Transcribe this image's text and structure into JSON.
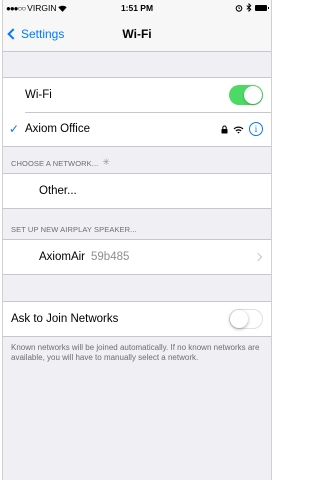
{
  "status_bar": {
    "signal": "●●●○○",
    "carrier": "VIRGIN",
    "time": "1:51 PM"
  },
  "nav": {
    "back_label": "Settings",
    "title": "Wi-Fi"
  },
  "wifi": {
    "label": "Wi-Fi",
    "enabled": true
  },
  "current_network": {
    "name": "Axiom Office",
    "info_glyph": "i"
  },
  "choose_network": {
    "header": "CHOOSE A NETWORK...",
    "other_label": "Other..."
  },
  "airplay": {
    "header": "SET UP NEW AIRPLAY SPEAKER...",
    "device_name": "AxiomAir",
    "device_id": "59b485"
  },
  "ask_to_join": {
    "label": "Ask to Join Networks",
    "enabled": false,
    "note": "Known networks will be joined automatically. If no known networks are available, you will have to manually select a network."
  },
  "colors": {
    "accent": "#007aff",
    "toggle_on": "#4cd964"
  }
}
